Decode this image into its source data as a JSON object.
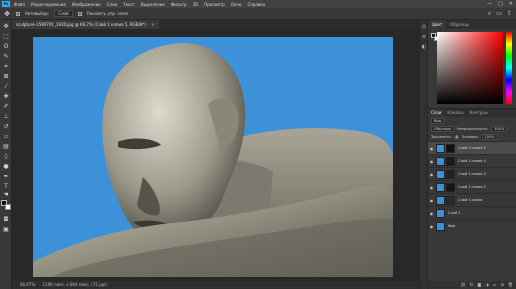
{
  "app": {
    "logo": "Ps"
  },
  "menu": [
    "Файл",
    "Редактирование",
    "Изображение",
    "Слои",
    "Текст",
    "Выделение",
    "Фильтр",
    "3D",
    "Просмотр",
    "Окно",
    "Справка"
  ],
  "window_controls": [
    "—",
    "□",
    "✕"
  ],
  "options": {
    "tool_icon": "move-icon",
    "autoselect_label": "Автовыбор:",
    "autoselect_value": "Слой",
    "transform_label": "Показать упр. элем."
  },
  "document": {
    "tab_title": "sculpture-1596701_1920.jpg @ 66,7% (Слой 1 копия 5, RGB/8*)"
  },
  "status": {
    "zoom": "66,67%",
    "info": "1296 пикс. x 864 пикс. (72 ppi)"
  },
  "color_panel": {
    "tabs": [
      "Цвет",
      "Образцы"
    ]
  },
  "layers_panel": {
    "tabs": [
      "Слои",
      "Каналы",
      "Контуры"
    ],
    "kind_label": "Вид",
    "blend_mode": "Обычные",
    "opacity_label": "Непрозрачность:",
    "opacity_value": "100%",
    "lock_label": "Закрепить:",
    "fill_label": "Заливка:",
    "fill_value": "100%",
    "layers": [
      {
        "name": "Слой 1 копия 5",
        "selected": true
      },
      {
        "name": "Слой 1 копия 4",
        "selected": false
      },
      {
        "name": "Слой 1 копия 3",
        "selected": false
      },
      {
        "name": "Слой 1 копия 2",
        "selected": false
      },
      {
        "name": "Слой 1 копия",
        "selected": false
      },
      {
        "name": "Слой 1",
        "selected": false
      },
      {
        "name": "Фон",
        "selected": false
      }
    ]
  },
  "colors": {
    "canvas_bg": "#282828",
    "sky": "#3d91d8",
    "selected_layer": "#4b4b4b"
  }
}
